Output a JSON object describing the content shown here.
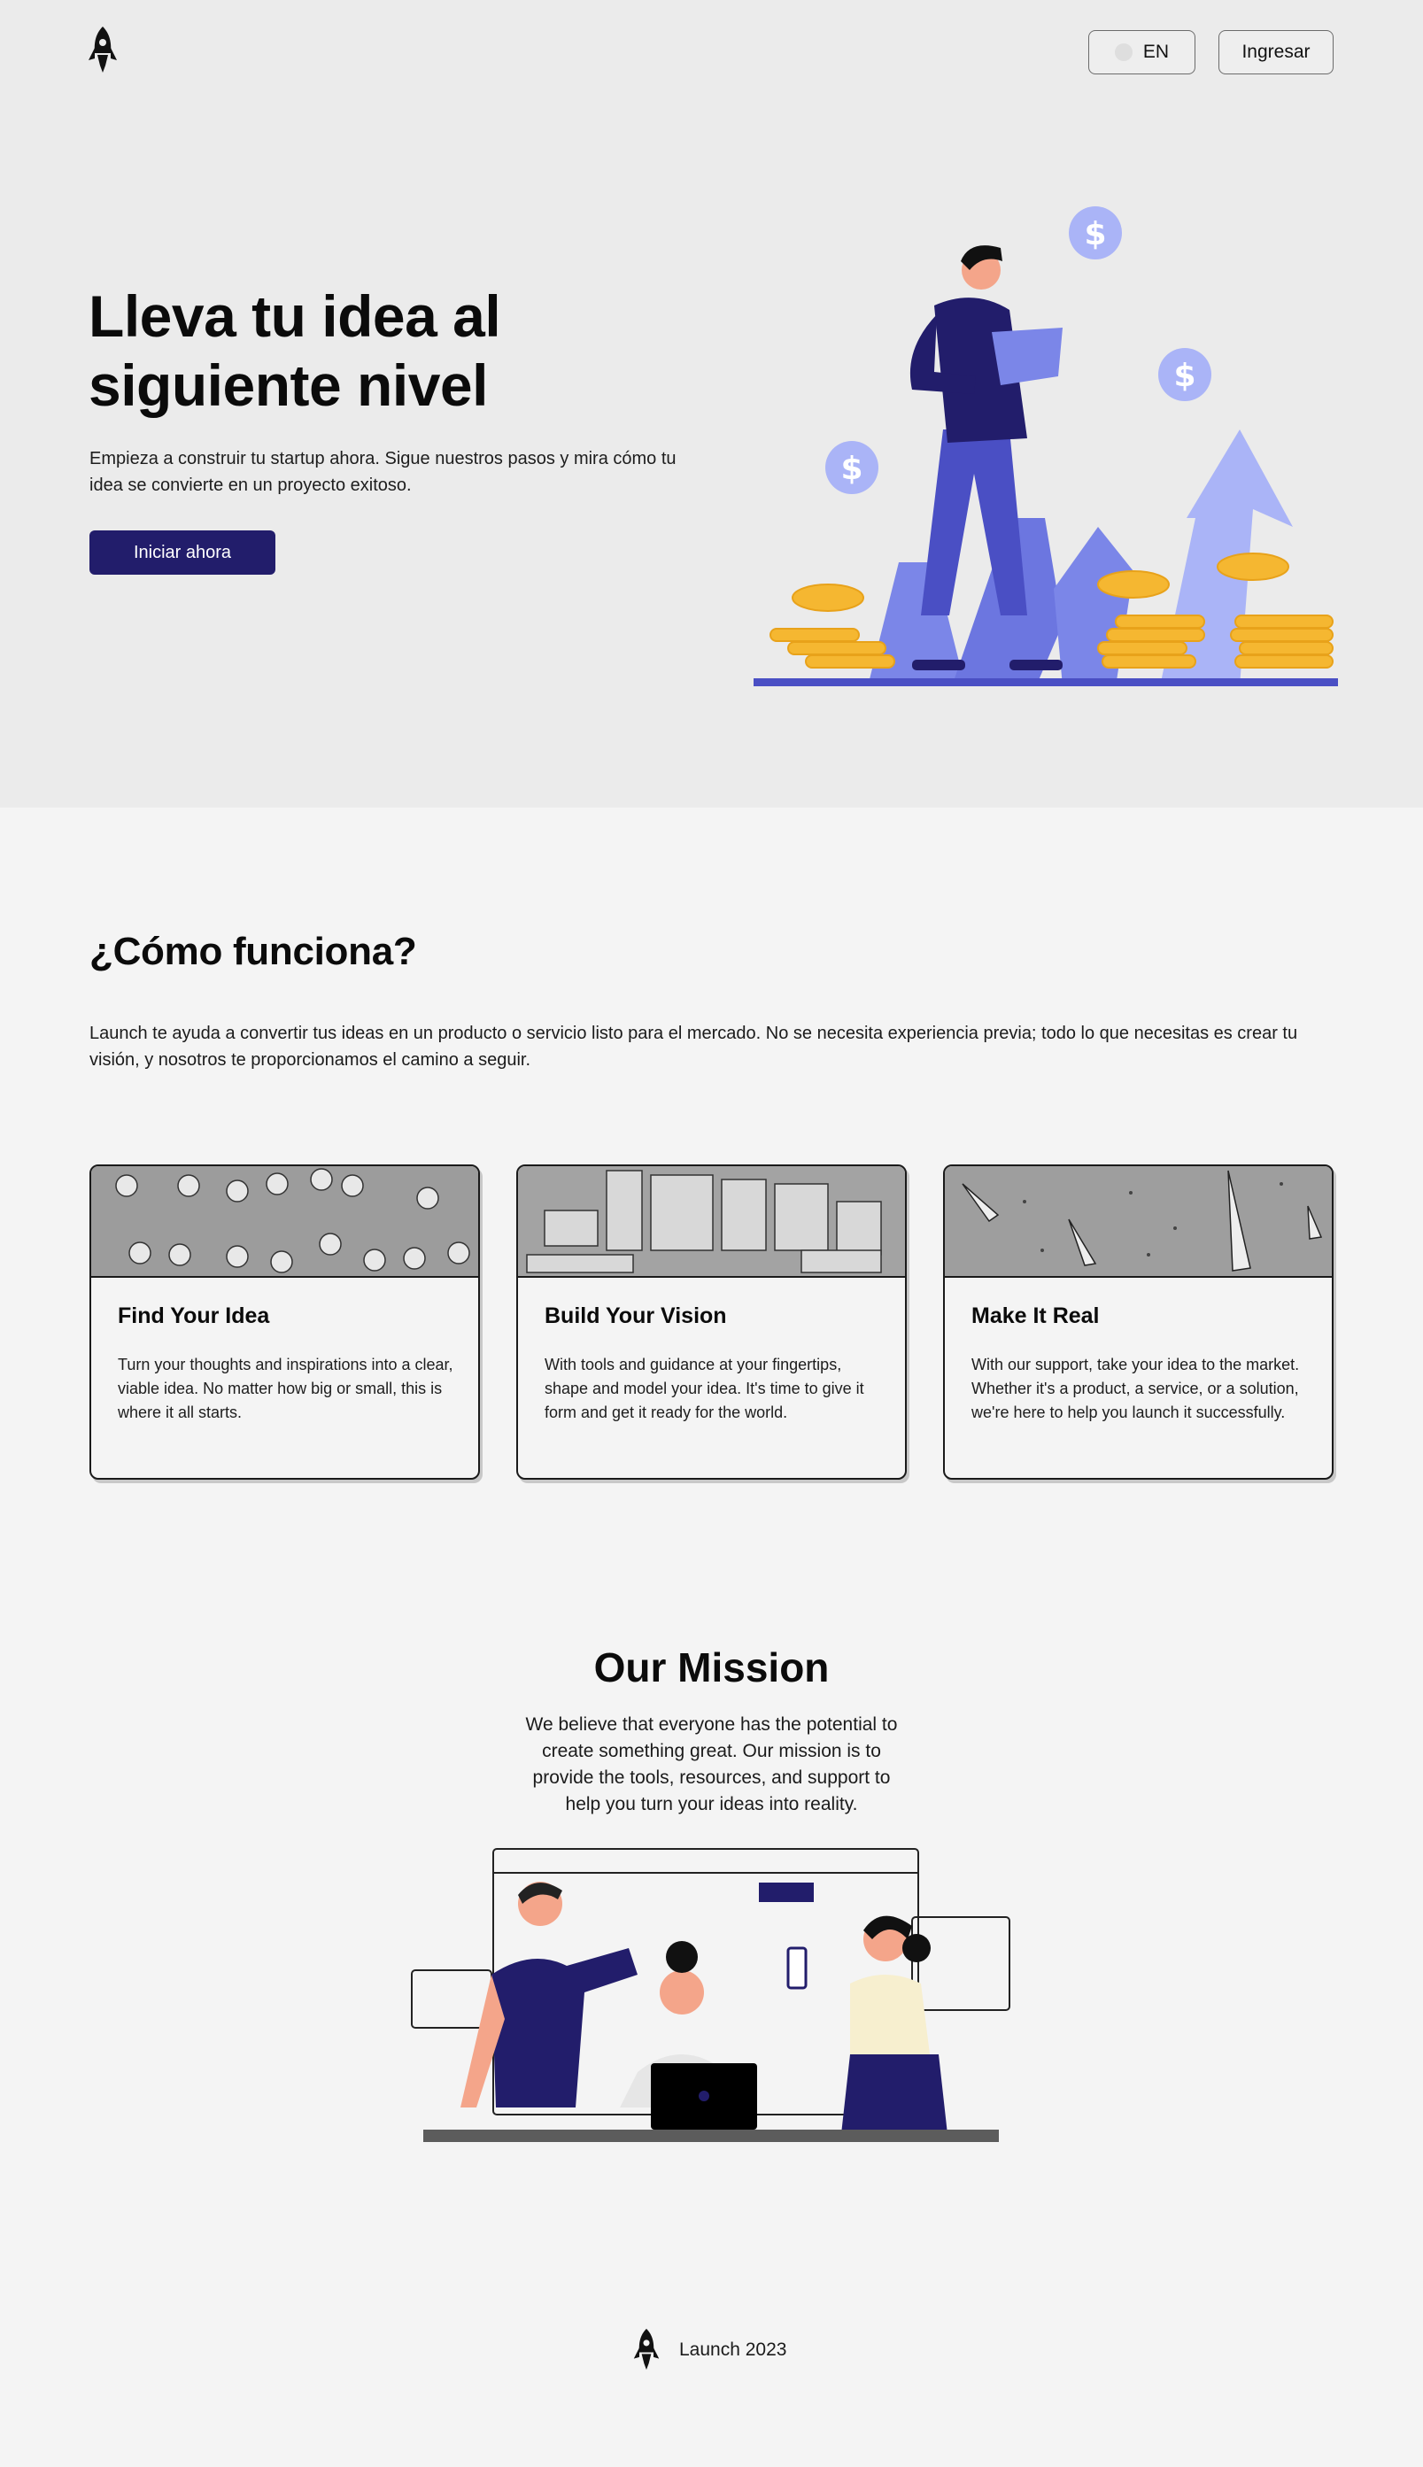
{
  "header": {
    "logo_icon": "rocket-icon",
    "language_label": "EN",
    "language_icon": "globe-icon",
    "login_label": "Ingresar"
  },
  "hero": {
    "title": "Lleva tu idea al siguiente nivel",
    "subtitle": "Empieza a construir tu startup ahora. Sigue nuestros pasos y mira cómo tu idea se convierte en un proyecto exitoso.",
    "cta_label": "Iniciar ahora",
    "illustration": "man-with-laptop-rising-arrows-coins"
  },
  "how": {
    "title": "¿Cómo funciona?",
    "description": "Launch te ayuda a convertir tus ideas en un producto o servicio listo para el mercado. No se necesita experiencia previa; todo lo que necesitas es crear tu visión, y nosotros te proporcionamos el camino a seguir.",
    "cards": [
      {
        "title": "Find Your Idea",
        "text": "Turn your thoughts and inspirations into a clear, viable idea. No matter how big or small, this is where it all starts.",
        "image": "lightbulbs-pattern"
      },
      {
        "title": "Build Your Vision",
        "text": "With tools and guidance at your fingertips, shape and model your idea. It's time to give it form and get it ready for the world.",
        "image": "books-pattern"
      },
      {
        "title": "Make It Real",
        "text": "With our support, take your idea to the market. Whether it's a product, a service, or a solution, we're here to help you launch it successfully.",
        "image": "rockets-pattern"
      }
    ]
  },
  "mission": {
    "title": "Our Mission",
    "text": "We believe that everyone has the potential to create something great. Our mission is to provide the tools, resources, and support to help you turn your ideas into reality.",
    "illustration": "team-collaboration"
  },
  "footer": {
    "logo_icon": "rocket-icon",
    "text": "Launch 2023"
  },
  "colors": {
    "primary": "#221d6b",
    "accent": "#4a4fc4",
    "light_accent": "#aab4f7",
    "coin": "#f5b731",
    "hero_bg": "#ebebeb",
    "page_bg": "#f4f4f4"
  }
}
